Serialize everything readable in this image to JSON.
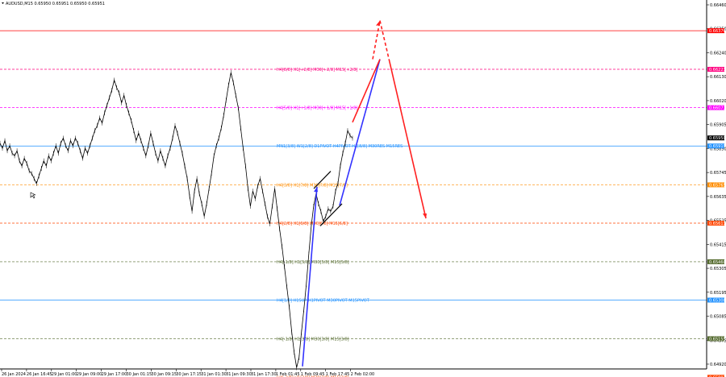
{
  "header": {
    "symbol_line": "AUDUSD,M15  0.65950 0.65951 0.65950 0.65951"
  },
  "chart_data": {
    "type": "line",
    "title": "AUDUSD,M15",
    "ylim": [
      0.65035,
      0.66485
    ],
    "y_ticks": [
      "0.66460",
      "0.66350",
      "0.66240",
      "0.66130",
      "0.66020",
      "0.65905",
      "0.65850",
      "0.65745",
      "0.65635",
      "0.65525",
      "0.65415",
      "0.65305",
      "0.65195",
      "0.65085",
      "0.64975",
      "0.64920"
    ],
    "x_ticks": [
      "26 Jan 2024",
      "26 Jan 16:45",
      "29 Jan 01:00",
      "29 Jan 09:00",
      "29 Jan 17:00",
      "30 Jan 01:15",
      "30 Jan 09:15",
      "30 Jan 17:15",
      "31 Jan 01:30",
      "31 Jan 09:30",
      "31 Jan 17:30",
      "1 Feb 01:45",
      "1 Feb 09:45",
      "1 Feb 17:45",
      "2 Feb 02:00"
    ],
    "levels": [
      {
        "price": "0.66376",
        "value": 0.66376,
        "color": "#ff0000",
        "label": "",
        "style": "solid"
      },
      {
        "price": "0.66223",
        "value": 0.66223,
        "color": "#ff007f",
        "label": "H4[8/8] H1[+2/8] M30[+2/8] M15[+2/8]",
        "style": "dashed"
      },
      {
        "price": "0.66071",
        "value": 0.66071,
        "color": "#ff00ff",
        "label": "H4[5/8] H1[+1/8] M30[+1/8] M15[+1/8]",
        "style": "dashed"
      },
      {
        "price": "0.65950",
        "value": 0.65951,
        "color": "#000000",
        "label": "",
        "style": "none"
      },
      {
        "price": "0.65919",
        "value": 0.65919,
        "color": "#1e90ff",
        "label": "MN1[3/8] W1[2/8] D1PIVOT H4PIVOT H1[8/8] M30RES M15RES",
        "style": "solid"
      },
      {
        "price": "0.65765",
        "value": 0.65765,
        "color": "#ff8c00",
        "label": "H4[3/8] H1[7/8] M30[7/8] M15[7/8]",
        "style": "dashed"
      },
      {
        "price": "0.65613",
        "value": 0.65613,
        "color": "#ff4500",
        "label": "H4[2/8] H1[6/8] M30[6/8] M15[6/8]",
        "style": "dashed"
      },
      {
        "price": "0.65460",
        "value": 0.6546,
        "color": "#556b2f",
        "label": "H4[-1/8] H1[5/8] M30[5/8] M15[5/8]",
        "style": "dashed"
      },
      {
        "price": "0.65308",
        "value": 0.65308,
        "color": "#1e90ff",
        "label": "H4[1/8] H1SUP H1PIVOT M30PIVOT M15PIVOT",
        "style": "solid"
      },
      {
        "price": "0.65155",
        "value": 0.65155,
        "color": "#556b2f",
        "label": "H4[-1/8] H1[3/8] M30[3/8] M15[3/8]",
        "style": "dashed"
      },
      {
        "price": "0.65002",
        "value": 0.65002,
        "color": "#ff4500",
        "label": "H4[-2/8] H1[2/8] M30[2/8] M15[2/8]",
        "style": "dashed"
      }
    ],
    "series": [
      {
        "values": [
          0.6593,
          0.6591,
          0.6594,
          0.659,
          0.6592,
          0.6589,
          0.6588,
          0.659,
          0.6586,
          0.6584,
          0.6587,
          0.6585,
          0.6582,
          0.6581,
          0.6579,
          0.6577,
          0.658,
          0.6583,
          0.6586,
          0.6584,
          0.6588,
          0.6586,
          0.6589,
          0.6592,
          0.6589,
          0.6593,
          0.6595,
          0.6592,
          0.659,
          0.6594,
          0.6592,
          0.6595,
          0.6593,
          0.659,
          0.6587,
          0.6591,
          0.6589,
          0.6592,
          0.6595,
          0.6598,
          0.66,
          0.6603,
          0.6601,
          0.6605,
          0.6608,
          0.6611,
          0.6614,
          0.6618,
          0.6615,
          0.6613,
          0.6609,
          0.6612,
          0.6608,
          0.6605,
          0.6602,
          0.6598,
          0.6594,
          0.6597,
          0.6594,
          0.6591,
          0.6588,
          0.6592,
          0.6597,
          0.6593,
          0.6589,
          0.6586,
          0.659,
          0.6587,
          0.6584,
          0.6588,
          0.6591,
          0.6595,
          0.66,
          0.6597,
          0.6593,
          0.6589,
          0.6584,
          0.6579,
          0.6572,
          0.6566,
          0.6574,
          0.6579,
          0.6573,
          0.6569,
          0.6564,
          0.6569,
          0.6575,
          0.6581,
          0.6588,
          0.6592,
          0.6595,
          0.6599,
          0.6604,
          0.661,
          0.6616,
          0.6621,
          0.6617,
          0.6612,
          0.6607,
          0.6599,
          0.6591,
          0.6584,
          0.6575,
          0.6568,
          0.6574,
          0.6571,
          0.6576,
          0.6579,
          0.6574,
          0.6569,
          0.6564,
          0.6561,
          0.6568,
          0.6575,
          0.6567,
          0.6559,
          0.6552,
          0.6544,
          0.6536,
          0.6528,
          0.6518,
          0.651,
          0.6504,
          0.6508,
          0.6518,
          0.6527,
          0.6537,
          0.6549,
          0.656,
          0.6568,
          0.6573,
          0.6569,
          0.6566,
          0.6562,
          0.6564,
          0.6567,
          0.6566,
          0.6568,
          0.6574,
          0.6577,
          0.6584,
          0.6589,
          0.6593,
          0.6598,
          0.6596,
          0.6595
        ]
      }
    ],
    "projection": [
      {
        "values": [
          0.65045,
          0.65757
        ],
        "color": "#3333ff",
        "dashed": false
      },
      {
        "values": [
          0.65683,
          0.66263
        ],
        "color": "#3333ff",
        "dashed": false
      },
      {
        "values": [
          0.66013,
          0.66263
        ],
        "color": "#ff2020",
        "dashed": false
      },
      {
        "values": [
          0.66263,
          0.66416
        ],
        "color": "#ff2020",
        "dashed": true
      },
      {
        "values": [
          0.66416,
          0.66252
        ],
        "color": "#ff2020",
        "dashed": true
      },
      {
        "values": [
          0.66252,
          0.65632
        ],
        "color": "#ff2020",
        "dashed": false
      }
    ],
    "channel_lines": [
      {
        "values": [
          0.6575,
          0.65819
        ],
        "color": "#000000"
      },
      {
        "values": [
          0.65602,
          0.6569
        ],
        "color": "#000000"
      }
    ]
  },
  "colors": {
    "background": "#ffffff",
    "price_line": "#000000",
    "axis": "#000000",
    "up_arrow": "#3333ff",
    "down_arrow": "#ff2020"
  }
}
